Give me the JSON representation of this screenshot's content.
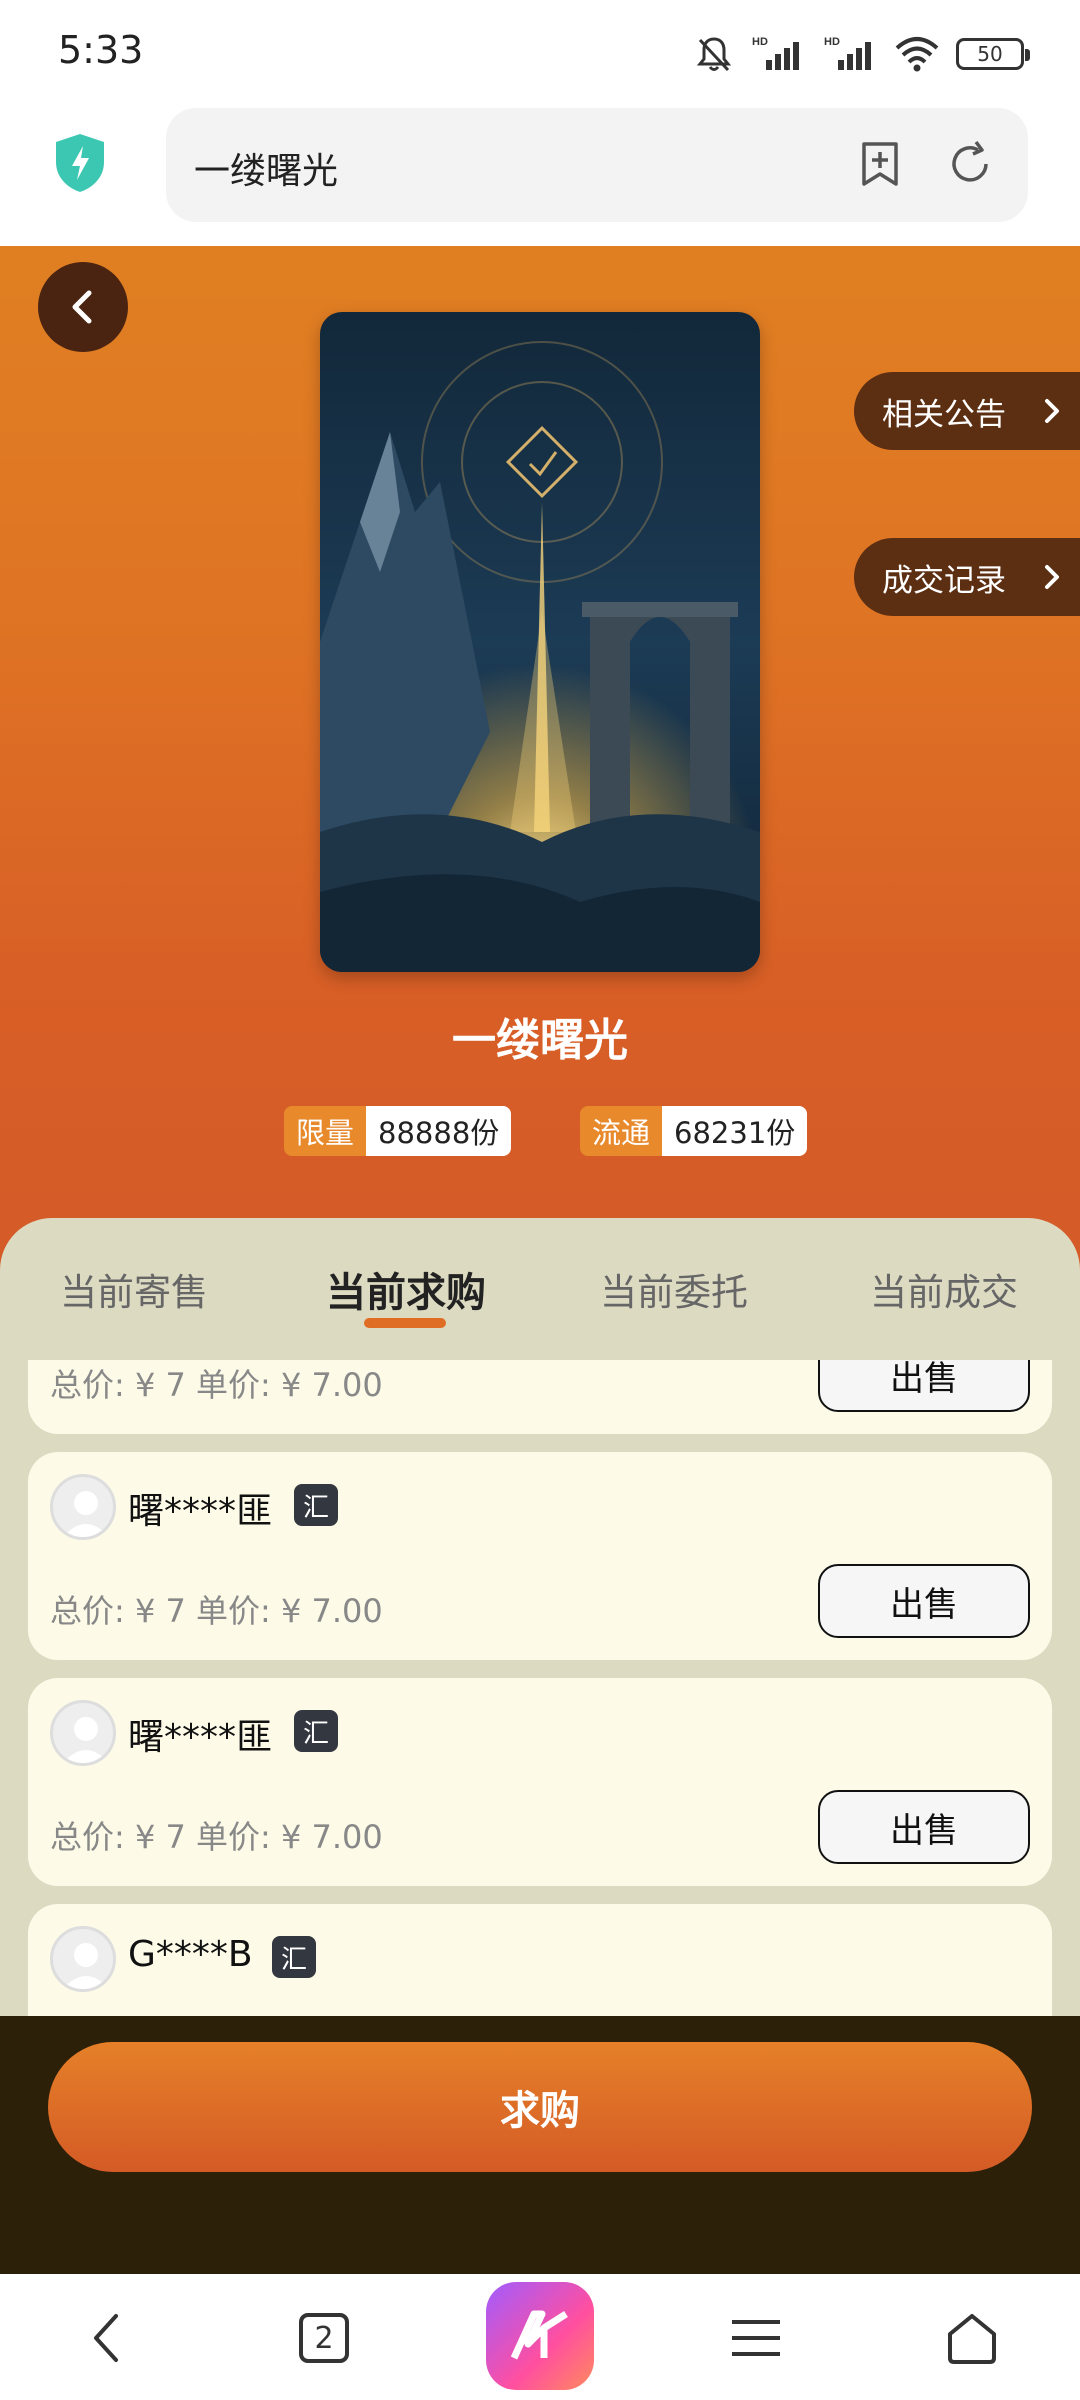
{
  "status_bar": {
    "time": "5:33",
    "battery": "50",
    "network_labels": [
      "HD",
      "HD"
    ]
  },
  "browser": {
    "url_text": "一缕曙光"
  },
  "hero": {
    "title": "一缕曙光",
    "side_buttons": [
      "相关公告",
      "成交记录"
    ],
    "limit_label": "限量",
    "limit_value": "88888份",
    "circulation_label": "流通",
    "circulation_value": "68231份"
  },
  "tabs": [
    {
      "label": "当前寄售",
      "active": false
    },
    {
      "label": "当前求购",
      "active": true
    },
    {
      "label": "当前委托",
      "active": false
    },
    {
      "label": "当前成交",
      "active": false
    }
  ],
  "orders": [
    {
      "user": "",
      "badge": "",
      "price": "总价: ¥ 7 单价: ¥ 7.00",
      "action": "出售"
    },
    {
      "user": "曙****匪",
      "badge": "汇",
      "price": "总价: ¥ 7 单价: ¥ 7.00",
      "action": "出售"
    },
    {
      "user": "曙****匪",
      "badge": "汇",
      "price": "总价: ¥ 7 单价: ¥ 7.00",
      "action": "出售"
    },
    {
      "user": "G****B",
      "badge": "汇",
      "price": "",
      "action": ""
    }
  ],
  "buy_button": "求购",
  "nav": {
    "tab_count": "2"
  },
  "colors": {
    "accent": "#e06d24",
    "hero_top": "#e07f22",
    "hero_bottom": "#d45a28",
    "panel_bg": "#dddac2",
    "card_bg": "#fdfbe8",
    "action_bar_bg": "#2c2009"
  },
  "icons": [
    "notifications-off-icon",
    "signal-icon",
    "wifi-icon",
    "battery-icon",
    "shield-bolt-icon",
    "bookmark-add-icon",
    "refresh-icon",
    "back-arrow-icon",
    "chevron-right-icon",
    "user-avatar-icon",
    "nav-back-icon",
    "tabs-icon",
    "app-logo-icon",
    "menu-icon",
    "home-icon"
  ]
}
